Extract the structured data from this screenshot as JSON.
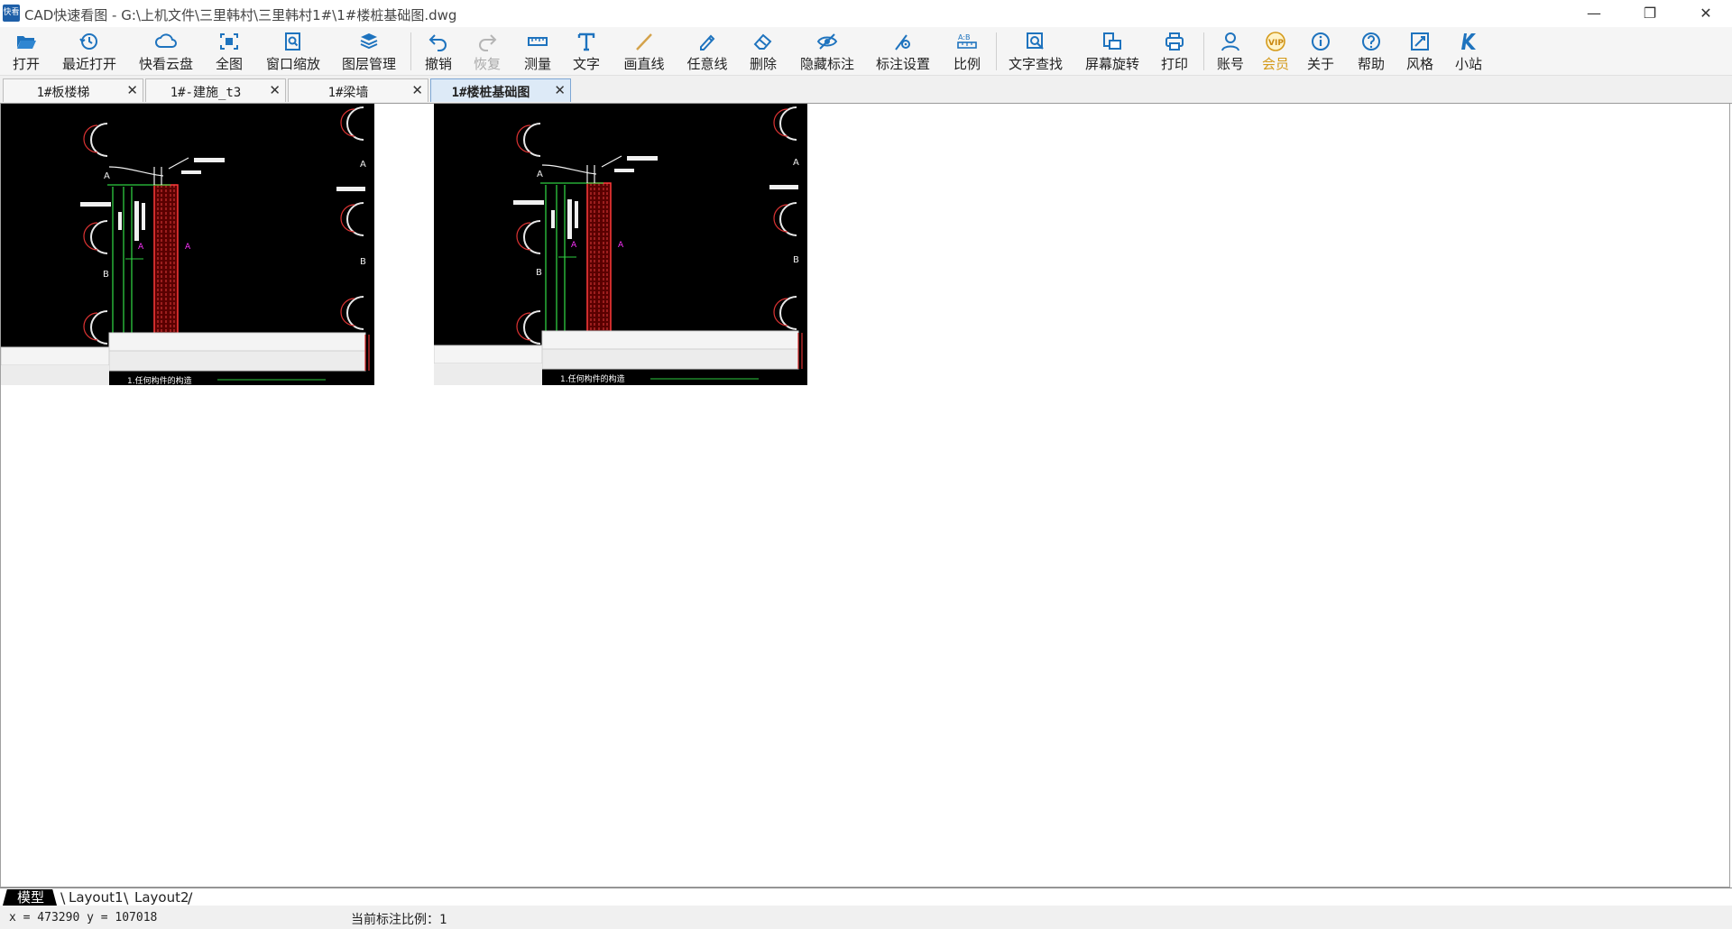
{
  "window": {
    "app_icon_text": "快看",
    "title": "CAD快速看图 - G:\\上机文件\\三里韩村\\三里韩村1#\\1#楼桩基础图.dwg",
    "minimize_glyph": "—",
    "restore_glyph": "❐",
    "close_glyph": "✕"
  },
  "toolbar": {
    "items": [
      {
        "label": "打开",
        "icon": "folder-open-icon"
      },
      {
        "label": "最近打开",
        "icon": "history-icon"
      },
      {
        "label": "快看云盘",
        "icon": "cloud-icon"
      },
      {
        "label": "全图",
        "icon": "fit-all-icon"
      },
      {
        "label": "窗口缩放",
        "icon": "zoom-window-icon"
      },
      {
        "label": "图层管理",
        "icon": "layers-icon"
      },
      {
        "label": "撤销",
        "icon": "undo-icon"
      },
      {
        "label": "恢复",
        "icon": "redo-icon",
        "disabled": true
      },
      {
        "label": "测量",
        "icon": "ruler-icon"
      },
      {
        "label": "文字",
        "icon": "text-icon"
      },
      {
        "label": "画直线",
        "icon": "line-icon"
      },
      {
        "label": "任意线",
        "icon": "pen-icon"
      },
      {
        "label": "删除",
        "icon": "eraser-icon"
      },
      {
        "label": "隐藏标注",
        "icon": "eye-icon"
      },
      {
        "label": "标注设置",
        "icon": "dimension-settings-icon"
      },
      {
        "label": "比例",
        "icon": "scale-icon"
      },
      {
        "label": "文字查找",
        "icon": "text-search-icon"
      },
      {
        "label": "屏幕旋转",
        "icon": "rotate-screen-icon"
      },
      {
        "label": "打印",
        "icon": "printer-icon"
      },
      {
        "label": "账号",
        "icon": "user-icon"
      },
      {
        "label": "会员",
        "icon": "vip-icon",
        "vip": true
      },
      {
        "label": "关于",
        "icon": "info-icon"
      },
      {
        "label": "帮助",
        "icon": "help-icon"
      },
      {
        "label": "风格",
        "icon": "style-icon"
      },
      {
        "label": "小站",
        "icon": "k-station-icon"
      }
    ],
    "accent_color": "#1e73be",
    "vip_color": "#d49a1a"
  },
  "tabs": [
    {
      "label": "1#板楼梯",
      "close": "✕"
    },
    {
      "label": "1#-建施_t3",
      "close": "✕"
    },
    {
      "label": "1#梁墙",
      "close": "✕"
    },
    {
      "label": "1#楼桩基础图",
      "close": "✕",
      "active": true
    }
  ],
  "drawing": {
    "annotation": "A",
    "section_b": "B",
    "footer_text": "1.任何构件的构造"
  },
  "layout_tabs": [
    "模型",
    "Layout1",
    "Layout2"
  ],
  "status": {
    "coords": "x = 473290 y = 107018",
    "scale": "当前标注比例：1"
  }
}
